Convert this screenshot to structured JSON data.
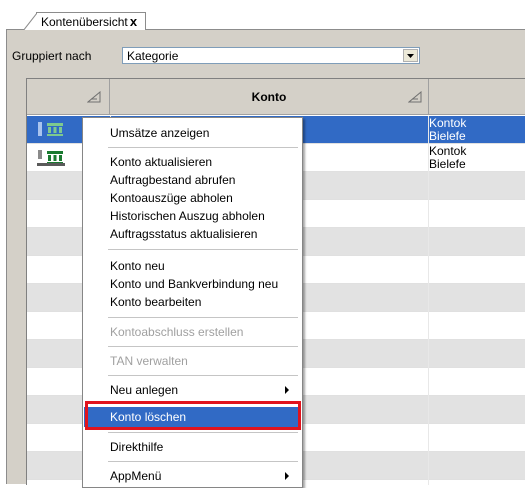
{
  "tab": {
    "title": "Kontenübersicht",
    "close_glyph": "x"
  },
  "grouping": {
    "label": "Gruppiert nach",
    "value": "Kategorie"
  },
  "grid": {
    "columns": [
      {
        "title": ""
      },
      {
        "title": "Konto"
      }
    ],
    "rows": [
      {
        "icon": "bank-hbci-icon",
        "icon_text": "HBCI",
        "line1": "Kontok",
        "line2": "Bielefe",
        "selected": true
      },
      {
        "icon": "bank-pintan-icon",
        "icon_text": "PIN/TAN",
        "line1": "Kontok",
        "line2": "Bielefe",
        "selected": false
      }
    ]
  },
  "context_menu": {
    "items": [
      {
        "label": "Umsätze anzeigen"
      },
      {
        "label": "Konto aktualisieren"
      },
      {
        "label": "Auftragbestand abrufen"
      },
      {
        "label": "Kontoauszüge abholen"
      },
      {
        "label": "Historischen Auszug abholen"
      },
      {
        "label": "Auftragsstatus aktualisieren"
      },
      {
        "label": "Konto neu"
      },
      {
        "label": "Konto und Bankverbindung neu"
      },
      {
        "label": "Konto bearbeiten"
      },
      {
        "label": "Kontoabschluss erstellen",
        "disabled": true
      },
      {
        "label": "TAN verwalten",
        "disabled": true
      },
      {
        "label": "Neu anlegen",
        "submenu": true
      },
      {
        "label": "Konto löschen",
        "highlighted": true
      },
      {
        "label": "Direkthilfe"
      },
      {
        "label": "AppMenü",
        "submenu": true
      }
    ]
  },
  "colors": {
    "selection": "#316ac5",
    "highlight_box": "#e0141e",
    "bank_icon": "#1a7a30"
  }
}
